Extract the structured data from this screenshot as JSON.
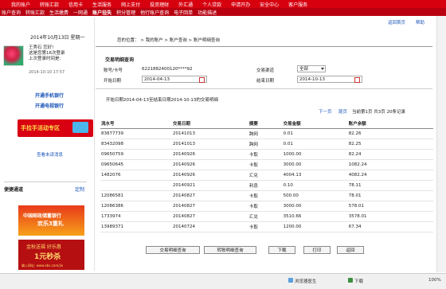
{
  "nav": {
    "row1": [
      "我的账户",
      "转账汇款",
      "信用卡",
      "生活服务",
      "网上支付",
      "投资理财",
      "外汇通",
      "个人贷款",
      "申请开办",
      "安全中心",
      "客户服务"
    ],
    "row2": [
      "账户查询",
      "转账汇款",
      "生活缴费",
      "一网通",
      "账户挂失",
      "积分管理",
      "他行账户查询",
      "电子回单",
      "功能描述"
    ],
    "active_index": 4,
    "util": [
      "返回首页",
      "帮助"
    ]
  },
  "sidebar": {
    "date": "2014年10月13日  星期一",
    "user_name": "王秀石 您好!",
    "user_line2": "这是您第16次登录",
    "user_line3": "上次登录时间是:",
    "login_time": "2014-10-10 17:57",
    "link_mobile": "开通手机银行",
    "link_tv": "开通电视银行",
    "promo_text": "手拉手活动专区",
    "unread": "查看未读消息",
    "fast_label": "便捷通道",
    "custom_label": "定制",
    "ad1_line1": "中国邮政储蓄银行",
    "ad1_line2": "欢乐3重礼",
    "ad2_line1": "金秋送福 好乐惠",
    "ad2_line2": "1元秒杀",
    "ad2_line3": "输入网址: www.ebs.com/jin"
  },
  "breadcrumb": "您的位置： > 我的账户 > 账户查询 > 账户明细查询",
  "query": {
    "title": "交易明细查询",
    "acct_label": "账号/卡号",
    "acct_value": "6221882400120****92",
    "channel_label": "交易渠道",
    "channel_value": "全部",
    "start_label": "开始日期",
    "start_value": "2014-04-13",
    "end_label": "结束日期",
    "end_value": "2014-10-13"
  },
  "result": {
    "range_text": "开始日期2014-04-13至结束日期2014-10-13的交易明细",
    "next": "下一页",
    "last": "尾页",
    "page_info": "当前第1页 共3页 20条记录"
  },
  "table": {
    "headers": [
      "流水号",
      "交易日期",
      "摘要",
      "交易金额",
      "账户余额"
    ],
    "rows": [
      [
        "83877739",
        "20141013",
        "跨网",
        "0.01",
        "82.26"
      ],
      [
        "83432098",
        "20141013",
        "跨网",
        "0.01",
        "82.25"
      ],
      [
        "09650759",
        "20140926",
        "卡取",
        "1000.00",
        "82.24"
      ],
      [
        "09650645",
        "20140926",
        "卡取",
        "3000.00",
        "1082.24"
      ],
      [
        "1482076",
        "20140926",
        "汇兑",
        "4004.13",
        "4082.24"
      ],
      [
        "",
        "20140921",
        "利息",
        "0.10",
        "78.11"
      ],
      [
        "12086581",
        "20140827",
        "卡取",
        "500.00",
        "78.01"
      ],
      [
        "12086386",
        "20140827",
        "卡取",
        "3000.00",
        "578.01"
      ],
      [
        "1733974",
        "20140827",
        "汇兑",
        "3510.66",
        "3578.01"
      ],
      [
        "13989371",
        "20140724",
        "卡取",
        "1200.00",
        "67.34"
      ]
    ]
  },
  "buttons": [
    "交易明细查询",
    "转账明细查询",
    "下载",
    "打印",
    "返回"
  ],
  "statusbar": {
    "doctor": "浏览器医生",
    "download": "下载",
    "zoom": "100%"
  },
  "colors": {
    "nav_red": "#d7000f",
    "link_blue": "#1a55b8"
  }
}
